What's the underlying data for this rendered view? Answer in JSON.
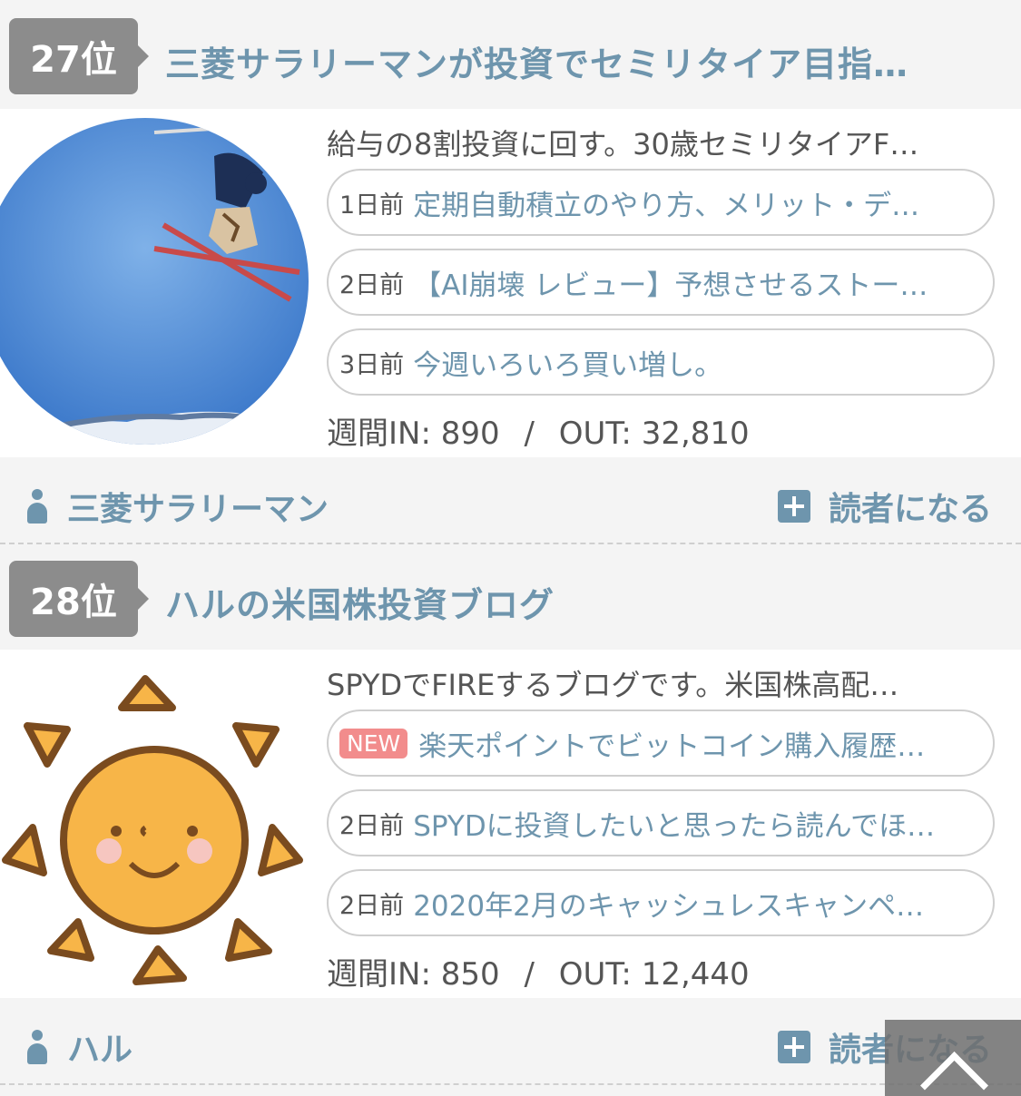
{
  "entries": [
    {
      "rank": "27位",
      "title": "三菱サラリーマンが投資でセミリタイア目指…",
      "description": "給与の8割投資に回す。30歳セミリタイアF…",
      "posts": [
        {
          "when": "1日前",
          "title": "定期自動積立のやり方、メリット・デ…"
        },
        {
          "when": "2日前",
          "title": "【AI崩壊 レビュー】予想させるストー…"
        },
        {
          "when": "3日前",
          "title": "今週いろいろ買い増し。"
        }
      ],
      "stats": {
        "in_label": "週間IN:",
        "in_value": "890",
        "sep": "/",
        "out_label": "OUT:",
        "out_value": "32,810"
      },
      "author": "三菱サラリーマン",
      "subscribe": "読者になる",
      "thumb_icon": "skier-photo"
    },
    {
      "rank": "28位",
      "title": "ハルの米国株投資ブログ",
      "description": "SPYDでFIREするブログです。米国株高配…",
      "posts": [
        {
          "badge": "NEW",
          "title": "楽天ポイントでビットコイン購入履歴…"
        },
        {
          "when": "2日前",
          "title": "SPYDに投資したいと思ったら読んでほ…"
        },
        {
          "when": "2日前",
          "title": "2020年2月のキャッシュレスキャンペ…"
        }
      ],
      "stats": {
        "in_label": "週間IN:",
        "in_value": "850",
        "sep": "/",
        "out_label": "OUT:",
        "out_value": "12,440"
      },
      "author": "ハル",
      "subscribe": "読者になる",
      "thumb_icon": "sun-illustration"
    }
  ],
  "colors": {
    "accent": "#6e95ad",
    "badge": "#8c8c8c",
    "new_badge": "#f28c8c"
  }
}
